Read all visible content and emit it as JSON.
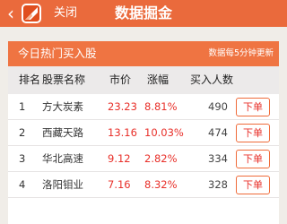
{
  "nav": {
    "back_glyph": "‹",
    "close_label": "关闭",
    "title": "数据掘金"
  },
  "card": {
    "title": "今日热门买入股",
    "note": "数据每5分钟更新"
  },
  "table": {
    "columns": [
      "排名",
      "股票名称",
      "市价",
      "涨幅",
      "买入人数"
    ],
    "rows": [
      {
        "rank": "1",
        "name": "方大炭素",
        "price": "23.23",
        "change": "8.81%",
        "count": "490",
        "action": "下单"
      },
      {
        "rank": "2",
        "name": "西藏天路",
        "price": "13.16",
        "change": "10.03%",
        "count": "474",
        "action": "下单"
      },
      {
        "rank": "3",
        "name": "华北高速",
        "price": "9.12",
        "change": "2.82%",
        "count": "334",
        "action": "下单"
      },
      {
        "rank": "4",
        "name": "洛阳钼业",
        "price": "7.16",
        "change": "8.32%",
        "count": "328",
        "action": "下单"
      }
    ]
  },
  "colors": {
    "nav_bg": "#ea6a3c",
    "header_bg": "#ef7442",
    "up_red": "#e8302a"
  },
  "icons": {
    "back": "chevron-left-icon",
    "logo": "app-logo-icon"
  }
}
